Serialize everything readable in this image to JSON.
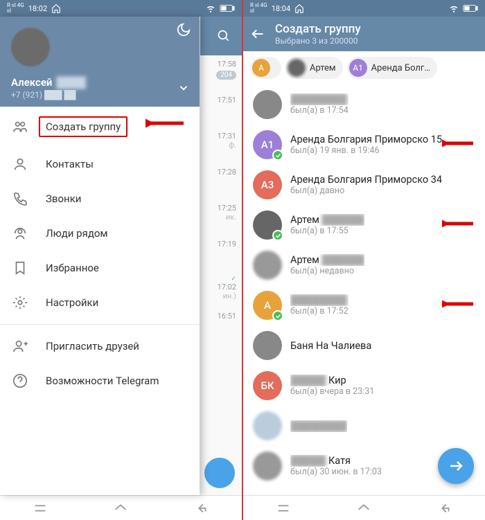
{
  "left": {
    "status_time": "18:02",
    "user_name": "Алексей",
    "user_phone": "+7 (921)",
    "menu": {
      "create_group": "Создать группу",
      "contacts": "Контакты",
      "calls": "Звонки",
      "nearby": "Люди рядом",
      "saved": "Избранное",
      "settings": "Настройки",
      "invite": "Пригласить друзей",
      "help": "Возможности Telegram"
    },
    "bg_times": [
      "17:58",
      "17:51",
      "17:31",
      "17:28",
      "17:25",
      "17:19",
      "17:02",
      "16:51"
    ],
    "bg_badge": "204",
    "bg_extra": "ин.)"
  },
  "right": {
    "status_time": "18:04",
    "title": "Создать группу",
    "subtitle": "Выбрано 3 из 200000",
    "chips": [
      {
        "letter": "А",
        "color": "#e8a23c",
        "name": "        "
      },
      {
        "letter": "",
        "color": "#666",
        "name": "Артем",
        "photo": true
      },
      {
        "letter": "А1",
        "color": "#9d7fd8",
        "name": "Аренда Болг…"
      }
    ],
    "contacts": [
      {
        "name": "",
        "status": "был(а) в 17:54",
        "color": "#888",
        "letter": "",
        "blurName": true,
        "photo": true
      },
      {
        "name": "Аренда Болгария Приморско 15",
        "status": "был(а) 19 янв. в 19:46",
        "color": "#9d7fd8",
        "letter": "А1",
        "checked": true,
        "arrow": true
      },
      {
        "name": "Аренда Болгария Приморско 34",
        "status": "был(а) давно",
        "color": "#e36c5a",
        "letter": "А3"
      },
      {
        "name": "Артем",
        "status": "был(а) в 17:55",
        "color": "#666",
        "letter": "",
        "photo": true,
        "checked": true,
        "arrow": true,
        "blurAfter": true
      },
      {
        "name": "Артем",
        "status": "был(а) недавно",
        "color": "#999",
        "letter": "",
        "photo": true,
        "blurAva": true,
        "blurAfter": true
      },
      {
        "name": "",
        "status": "был(а) в 17:52",
        "color": "#e8a23c",
        "letter": "А",
        "checked": true,
        "arrow": true,
        "blurName": true
      },
      {
        "name": "Баня На Чалиева",
        "status": "",
        "color": "#888",
        "letter": "",
        "photo": true
      },
      {
        "name": "           Кир",
        "status": "был(а) вчера в 23:31",
        "color": "#e36c5a",
        "letter": "БК",
        "blurPrefix": true
      },
      {
        "name": "",
        "status": "",
        "color": "#bcd",
        "letter": "",
        "photo": true,
        "blurAva": true,
        "blurName": true
      },
      {
        "name": "            Катя",
        "status": "был(а) 30 июн. в 17:03",
        "color": "#999",
        "letter": "",
        "photo": true,
        "blurAva": true,
        "blurPrefix": true
      }
    ]
  }
}
